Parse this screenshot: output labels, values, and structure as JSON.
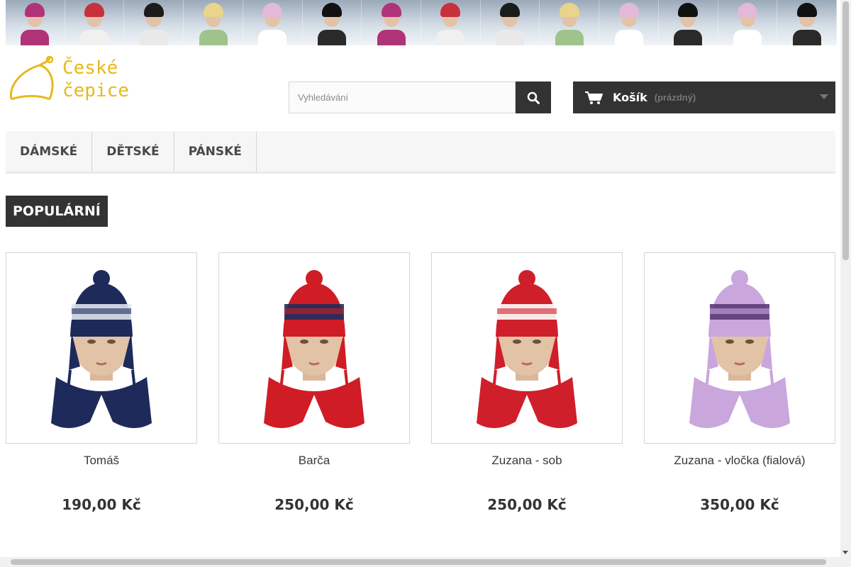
{
  "banner": {
    "alt": "winter hats banner",
    "faces": [
      {
        "hat": "#b0337a",
        "body": "#b0337a"
      },
      {
        "hat": "#c8313b",
        "body": "#f0f0f0"
      },
      {
        "hat": "#1c1c1c",
        "body": "#e9e9e9"
      },
      {
        "hat": "#e8d48a",
        "body": "#9ec48a"
      },
      {
        "hat": "#e2b9d9",
        "body": "#ffffff"
      },
      {
        "hat": "#111111",
        "body": "#2a2a2a"
      },
      {
        "hat": "#b0337a",
        "body": "#b0337a"
      },
      {
        "hat": "#c8313b",
        "body": "#f0f0f0"
      },
      {
        "hat": "#1c1c1c",
        "body": "#e9e9e9"
      },
      {
        "hat": "#e8d48a",
        "body": "#9ec48a"
      },
      {
        "hat": "#e2b9d9",
        "body": "#ffffff"
      },
      {
        "hat": "#111111",
        "body": "#2a2a2a"
      },
      {
        "hat": "#e2b9d9",
        "body": "#ffffff"
      },
      {
        "hat": "#111111",
        "body": "#2a2a2a"
      }
    ]
  },
  "logo": {
    "line1": "České",
    "line2": "čepice",
    "color": "#e7b91b"
  },
  "search": {
    "placeholder": "Vyhledávání",
    "icon": "search-icon"
  },
  "cart": {
    "label": "Košík",
    "status": "(prázdný)",
    "icon": "cart-icon"
  },
  "nav": {
    "items": [
      "DÁMSKÉ",
      "DĚTSKÉ",
      "PÁNSKÉ"
    ]
  },
  "section": {
    "title": "POPULÁRNÍ"
  },
  "products": [
    {
      "name": "Tomáš",
      "price": "190,00 Kč",
      "hat_color": "#1d2a5a",
      "accent": "#dfe3ef"
    },
    {
      "name": "Barča",
      "price": "250,00 Kč",
      "hat_color": "#d01c25",
      "accent": "#1e2d5c"
    },
    {
      "name": "Zuzana - sob",
      "price": "250,00 Kč",
      "hat_color": "#cf1f2a",
      "accent": "#ffffff"
    },
    {
      "name": "Zuzana - vločka (fialová)",
      "price": "350,00 Kč",
      "hat_color": "#c9a6dc",
      "accent": "#5a3b78"
    }
  ],
  "colors": {
    "dark": "#333333",
    "accent": "#e7b91b"
  }
}
